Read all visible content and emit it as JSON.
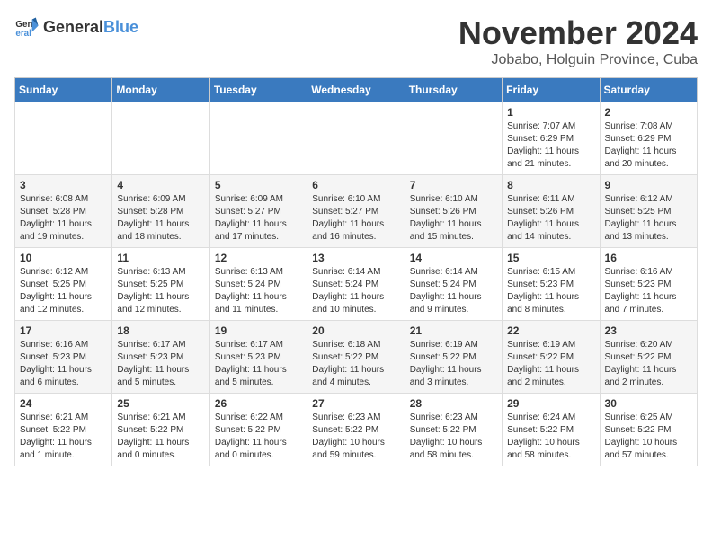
{
  "header": {
    "logo_general": "General",
    "logo_blue": "Blue",
    "title": "November 2024",
    "subtitle": "Jobabo, Holguin Province, Cuba"
  },
  "days_of_week": [
    "Sunday",
    "Monday",
    "Tuesday",
    "Wednesday",
    "Thursday",
    "Friday",
    "Saturday"
  ],
  "weeks": [
    [
      {
        "day": "",
        "info": ""
      },
      {
        "day": "",
        "info": ""
      },
      {
        "day": "",
        "info": ""
      },
      {
        "day": "",
        "info": ""
      },
      {
        "day": "",
        "info": ""
      },
      {
        "day": "1",
        "info": "Sunrise: 7:07 AM\nSunset: 6:29 PM\nDaylight: 11 hours\nand 21 minutes."
      },
      {
        "day": "2",
        "info": "Sunrise: 7:08 AM\nSunset: 6:29 PM\nDaylight: 11 hours\nand 20 minutes."
      }
    ],
    [
      {
        "day": "3",
        "info": "Sunrise: 6:08 AM\nSunset: 5:28 PM\nDaylight: 11 hours\nand 19 minutes."
      },
      {
        "day": "4",
        "info": "Sunrise: 6:09 AM\nSunset: 5:28 PM\nDaylight: 11 hours\nand 18 minutes."
      },
      {
        "day": "5",
        "info": "Sunrise: 6:09 AM\nSunset: 5:27 PM\nDaylight: 11 hours\nand 17 minutes."
      },
      {
        "day": "6",
        "info": "Sunrise: 6:10 AM\nSunset: 5:27 PM\nDaylight: 11 hours\nand 16 minutes."
      },
      {
        "day": "7",
        "info": "Sunrise: 6:10 AM\nSunset: 5:26 PM\nDaylight: 11 hours\nand 15 minutes."
      },
      {
        "day": "8",
        "info": "Sunrise: 6:11 AM\nSunset: 5:26 PM\nDaylight: 11 hours\nand 14 minutes."
      },
      {
        "day": "9",
        "info": "Sunrise: 6:12 AM\nSunset: 5:25 PM\nDaylight: 11 hours\nand 13 minutes."
      }
    ],
    [
      {
        "day": "10",
        "info": "Sunrise: 6:12 AM\nSunset: 5:25 PM\nDaylight: 11 hours\nand 12 minutes."
      },
      {
        "day": "11",
        "info": "Sunrise: 6:13 AM\nSunset: 5:25 PM\nDaylight: 11 hours\nand 12 minutes."
      },
      {
        "day": "12",
        "info": "Sunrise: 6:13 AM\nSunset: 5:24 PM\nDaylight: 11 hours\nand 11 minutes."
      },
      {
        "day": "13",
        "info": "Sunrise: 6:14 AM\nSunset: 5:24 PM\nDaylight: 11 hours\nand 10 minutes."
      },
      {
        "day": "14",
        "info": "Sunrise: 6:14 AM\nSunset: 5:24 PM\nDaylight: 11 hours\nand 9 minutes."
      },
      {
        "day": "15",
        "info": "Sunrise: 6:15 AM\nSunset: 5:23 PM\nDaylight: 11 hours\nand 8 minutes."
      },
      {
        "day": "16",
        "info": "Sunrise: 6:16 AM\nSunset: 5:23 PM\nDaylight: 11 hours\nand 7 minutes."
      }
    ],
    [
      {
        "day": "17",
        "info": "Sunrise: 6:16 AM\nSunset: 5:23 PM\nDaylight: 11 hours\nand 6 minutes."
      },
      {
        "day": "18",
        "info": "Sunrise: 6:17 AM\nSunset: 5:23 PM\nDaylight: 11 hours\nand 5 minutes."
      },
      {
        "day": "19",
        "info": "Sunrise: 6:17 AM\nSunset: 5:23 PM\nDaylight: 11 hours\nand 5 minutes."
      },
      {
        "day": "20",
        "info": "Sunrise: 6:18 AM\nSunset: 5:22 PM\nDaylight: 11 hours\nand 4 minutes."
      },
      {
        "day": "21",
        "info": "Sunrise: 6:19 AM\nSunset: 5:22 PM\nDaylight: 11 hours\nand 3 minutes."
      },
      {
        "day": "22",
        "info": "Sunrise: 6:19 AM\nSunset: 5:22 PM\nDaylight: 11 hours\nand 2 minutes."
      },
      {
        "day": "23",
        "info": "Sunrise: 6:20 AM\nSunset: 5:22 PM\nDaylight: 11 hours\nand 2 minutes."
      }
    ],
    [
      {
        "day": "24",
        "info": "Sunrise: 6:21 AM\nSunset: 5:22 PM\nDaylight: 11 hours\nand 1 minute."
      },
      {
        "day": "25",
        "info": "Sunrise: 6:21 AM\nSunset: 5:22 PM\nDaylight: 11 hours\nand 0 minutes."
      },
      {
        "day": "26",
        "info": "Sunrise: 6:22 AM\nSunset: 5:22 PM\nDaylight: 11 hours\nand 0 minutes."
      },
      {
        "day": "27",
        "info": "Sunrise: 6:23 AM\nSunset: 5:22 PM\nDaylight: 10 hours\nand 59 minutes."
      },
      {
        "day": "28",
        "info": "Sunrise: 6:23 AM\nSunset: 5:22 PM\nDaylight: 10 hours\nand 58 minutes."
      },
      {
        "day": "29",
        "info": "Sunrise: 6:24 AM\nSunset: 5:22 PM\nDaylight: 10 hours\nand 58 minutes."
      },
      {
        "day": "30",
        "info": "Sunrise: 6:25 AM\nSunset: 5:22 PM\nDaylight: 10 hours\nand 57 minutes."
      }
    ]
  ]
}
